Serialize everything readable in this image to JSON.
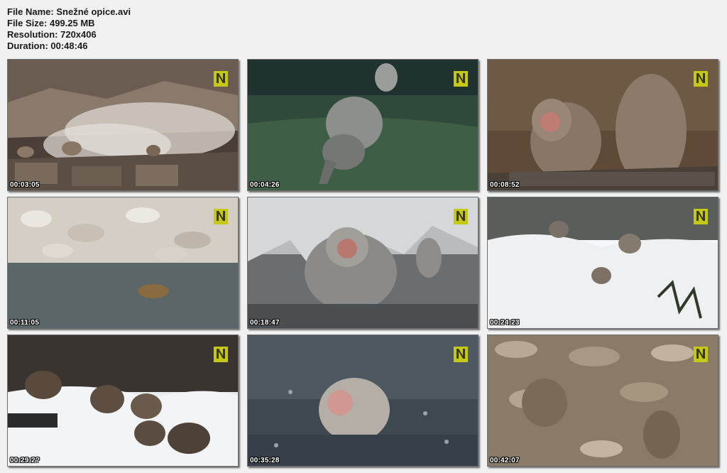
{
  "info": {
    "file_name": "File Name: Snežné opice.avi",
    "file_size": "File Size: 499.25 MB",
    "resolution": "Resolution: 720x406",
    "duration": "Duration: 00:48:46"
  },
  "thumbnails": [
    {
      "timestamp": "00:03:05",
      "scene": "steaming hot spring with monkeys on rocks"
    },
    {
      "timestamp": "00:04:26",
      "scene": "monkey leaping over green water"
    },
    {
      "timestamp": "00:08:52",
      "scene": "two monkeys on rock ledge"
    },
    {
      "timestamp": "00:11:05",
      "scene": "monkey swimming near stony bank"
    },
    {
      "timestamp": "00:18:47",
      "scene": "monkey bathing in snowy hot spring"
    },
    {
      "timestamp": "00:24:23",
      "scene": "monkeys in snowy bushes"
    },
    {
      "timestamp": "00:29:2?",
      "scene": "monkeys huddled on snowy slope"
    },
    {
      "timestamp": "00:35:28",
      "scene": "monkey face in rainy water"
    },
    {
      "timestamp": "00:42:07",
      "scene": "monkeys on rocky slope"
    }
  ],
  "colors": {
    "logo_yellow": "#c6c816",
    "frame_border": "#6e6e6e",
    "page_background": "#f1f1f1"
  }
}
